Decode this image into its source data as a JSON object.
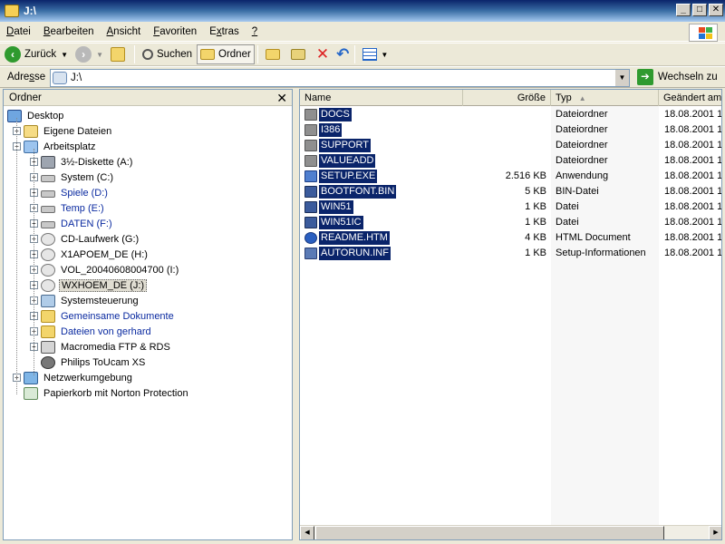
{
  "window": {
    "title": "J:\\"
  },
  "menu": [
    {
      "pre": "",
      "u": "D",
      "post": "atei"
    },
    {
      "pre": "",
      "u": "B",
      "post": "earbeiten"
    },
    {
      "pre": "",
      "u": "A",
      "post": "nsicht"
    },
    {
      "pre": "",
      "u": "F",
      "post": "avoriten"
    },
    {
      "pre": "E",
      "u": "x",
      "post": "tras"
    },
    {
      "pre": "",
      "u": "?",
      "post": ""
    }
  ],
  "toolbar": {
    "back": "Zurück",
    "search": "Suchen",
    "folders": "Ordner"
  },
  "address": {
    "label_pre": "Adre",
    "label_u": "s",
    "label_post": "se",
    "value": "J:\\",
    "go": "Wechseln zu"
  },
  "folders_pane": {
    "title": "Ordner"
  },
  "tree": [
    {
      "label": "Desktop",
      "icon": "desktop-icon",
      "cls": "ic-desktop",
      "depth": 0,
      "exp": "",
      "blue": false,
      "sel": false
    },
    {
      "label": "Eigene Dateien",
      "icon": "documents-icon",
      "cls": "ic-docs",
      "depth": 1,
      "exp": "+",
      "blue": false,
      "sel": false
    },
    {
      "label": "Arbeitsplatz",
      "icon": "computer-icon",
      "cls": "ic-pc",
      "depth": 1,
      "exp": "-",
      "blue": false,
      "sel": false
    },
    {
      "label": "3½-Diskette (A:)",
      "icon": "floppy-icon",
      "cls": "ic-floppy",
      "depth": 2,
      "exp": "+",
      "blue": false,
      "sel": false
    },
    {
      "label": "System (C:)",
      "icon": "drive-icon",
      "cls": "ic-drive",
      "depth": 2,
      "exp": "+",
      "blue": false,
      "sel": false
    },
    {
      "label": "Spiele (D:)",
      "icon": "drive-icon",
      "cls": "ic-drive",
      "depth": 2,
      "exp": "+",
      "blue": true,
      "sel": false
    },
    {
      "label": "Temp (E:)",
      "icon": "drive-icon",
      "cls": "ic-drive",
      "depth": 2,
      "exp": "+",
      "blue": true,
      "sel": false
    },
    {
      "label": "DATEN (F:)",
      "icon": "drive-icon",
      "cls": "ic-drive",
      "depth": 2,
      "exp": "+",
      "blue": true,
      "sel": false
    },
    {
      "label": "CD-Laufwerk (G:)",
      "icon": "cd-drive-icon",
      "cls": "ic-cd",
      "depth": 2,
      "exp": "+",
      "blue": false,
      "sel": false
    },
    {
      "label": "X1APOEM_DE (H:)",
      "icon": "cd-drive-icon",
      "cls": "ic-cd",
      "depth": 2,
      "exp": "+",
      "blue": false,
      "sel": false
    },
    {
      "label": "VOL_20040608004700 (I:)",
      "icon": "cd-drive-icon",
      "cls": "ic-cd",
      "depth": 2,
      "exp": "+",
      "blue": false,
      "sel": false
    },
    {
      "label": "WXHOEM_DE (J:)",
      "icon": "cd-drive-icon",
      "cls": "ic-cd",
      "depth": 2,
      "exp": "+",
      "blue": false,
      "sel": true
    },
    {
      "label": "Systemsteuerung",
      "icon": "control-panel-icon",
      "cls": "ic-ctrl",
      "depth": 2,
      "exp": "+",
      "blue": false,
      "sel": false
    },
    {
      "label": "Gemeinsame Dokumente",
      "icon": "folder-icon",
      "cls": "ic-folder",
      "depth": 2,
      "exp": "+",
      "blue": true,
      "sel": false
    },
    {
      "label": "Dateien von gerhard",
      "icon": "folder-icon",
      "cls": "ic-folder",
      "depth": 2,
      "exp": "+",
      "blue": true,
      "sel": false
    },
    {
      "label": "Macromedia FTP & RDS",
      "icon": "ftp-icon",
      "cls": "ic-ftp",
      "depth": 2,
      "exp": "+",
      "blue": false,
      "sel": false
    },
    {
      "label": "Philips ToUcam XS",
      "icon": "webcam-icon",
      "cls": "ic-cam",
      "depth": 2,
      "exp": "",
      "blue": false,
      "sel": false
    },
    {
      "label": "Netzwerkumgebung",
      "icon": "network-icon",
      "cls": "ic-net",
      "depth": 1,
      "exp": "+",
      "blue": false,
      "sel": false
    },
    {
      "label": "Papierkorb mit Norton Protection",
      "icon": "recycle-bin-icon",
      "cls": "ic-trash",
      "depth": 1,
      "exp": "",
      "blue": false,
      "sel": false
    }
  ],
  "columns": {
    "name": "Name",
    "size": "Größe",
    "type": "Typ",
    "modified": "Geändert am"
  },
  "files": [
    {
      "name": "DOCS",
      "size": "",
      "type": "Dateiordner",
      "date": "18.08.2001 1",
      "kind": "folder"
    },
    {
      "name": "I386",
      "size": "",
      "type": "Dateiordner",
      "date": "18.08.2001 1",
      "kind": "folder"
    },
    {
      "name": "SUPPORT",
      "size": "",
      "type": "Dateiordner",
      "date": "18.08.2001 1",
      "kind": "folder"
    },
    {
      "name": "VALUEADD",
      "size": "",
      "type": "Dateiordner",
      "date": "18.08.2001 1",
      "kind": "folder"
    },
    {
      "name": "SETUP.EXE",
      "size": "2.516 KB",
      "type": "Anwendung",
      "date": "18.08.2001 1",
      "kind": "app"
    },
    {
      "name": "BOOTFONT.BIN",
      "size": "5 KB",
      "type": "BIN-Datei",
      "date": "18.08.2001 1",
      "kind": "doc"
    },
    {
      "name": "WIN51",
      "size": "1 KB",
      "type": "Datei",
      "date": "18.08.2001 1",
      "kind": "doc"
    },
    {
      "name": "WIN51IC",
      "size": "1 KB",
      "type": "Datei",
      "date": "18.08.2001 1",
      "kind": "doc"
    },
    {
      "name": "README.HTM",
      "size": "4 KB",
      "type": "HTML Document",
      "date": "18.08.2001 1",
      "kind": "web"
    },
    {
      "name": "AUTORUN.INF",
      "size": "1 KB",
      "type": "Setup-Informationen",
      "date": "18.08.2001 1",
      "kind": "inf"
    }
  ]
}
